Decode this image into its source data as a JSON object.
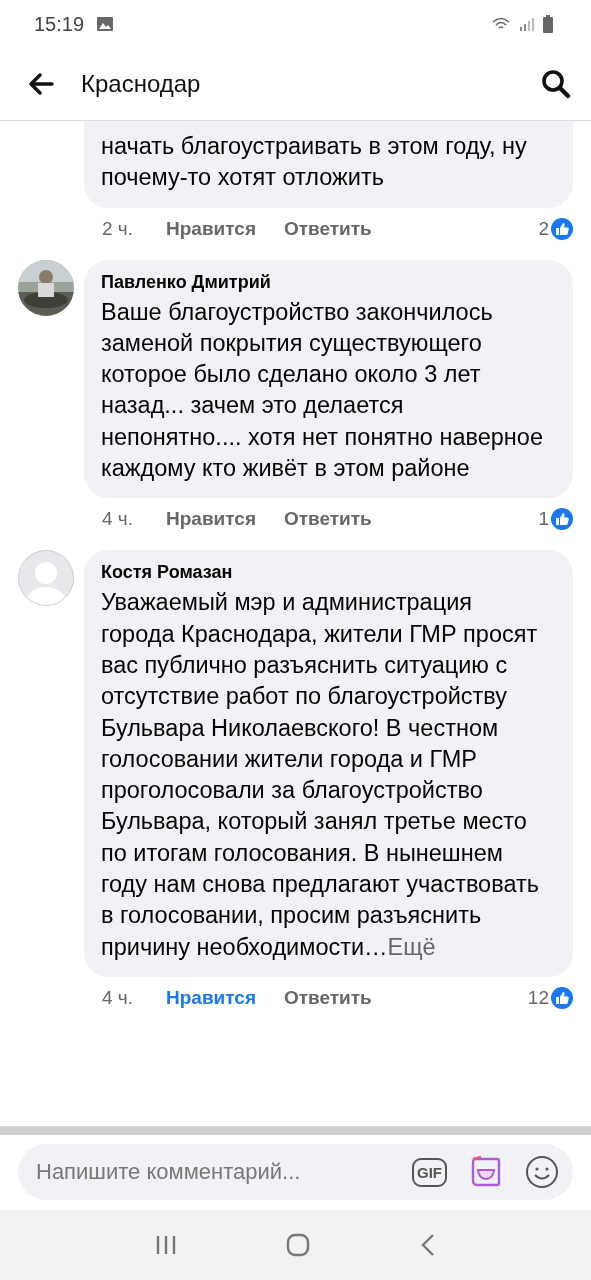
{
  "status_bar": {
    "time": "15:19"
  },
  "header": {
    "title": "Краснодар"
  },
  "comments": [
    {
      "text": "начать благоустраивать в этом году, ну почему-то хотят отложить",
      "time": "2 ч.",
      "like": "Нравится",
      "liked": false,
      "reply": "Ответить",
      "reactions": "2"
    },
    {
      "author": "Павленко Дмитрий",
      "text": "Ваше благоустройство закончилось заменой покрытия существующего которое было сделано около 3 лет назад... зачем это делается непонятно.... хотя нет понятно наверное каждому кто живёт в этом районе",
      "time": "4 ч.",
      "like": "Нравится",
      "liked": false,
      "reply": "Ответить",
      "reactions": "1"
    },
    {
      "author": "Костя Ромазан",
      "avatar": {
        "kind": "silhouette"
      },
      "text": "Уважаемый мэр и администрация города Краснодара, жители ГМР просят вас публично разъяснить ситуацию с отсутствие работ по благоустройству Бульвара Николаевского! В честном голосовании жители города и ГМР проголосовали за благоустройство Бульвара, который занял третье место по итогам голосования. В нынешнем году нам снова предлагают участвовать в голосовании, просим разъяснить причину необходимости…",
      "more": "Ещё",
      "time": "4 ч.",
      "like": "Нравится",
      "liked": true,
      "reply": "Ответить",
      "reactions": "12"
    }
  ],
  "composer": {
    "placeholder": "Напишите комментарий...",
    "gif": "GIF"
  }
}
